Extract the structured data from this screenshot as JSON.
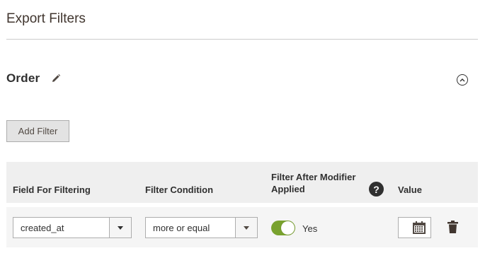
{
  "section": {
    "title": "Export Filters"
  },
  "order": {
    "title": "Order"
  },
  "actions": {
    "add_filter_label": "Add Filter"
  },
  "table": {
    "headers": {
      "field": "Field For Filtering",
      "condition": "Filter Condition",
      "modifier_line1": "Filter After Modifier",
      "modifier_line2": "Applied",
      "value": "Value"
    },
    "help_icon_glyph": "?",
    "row": {
      "field_value": "created_at",
      "condition_value": "more or equal",
      "modifier_toggle_label": "Yes",
      "modifier_toggle_on": true,
      "value": ""
    }
  },
  "colors": {
    "toggle_on": "#79a22e",
    "header_bg": "#efefef",
    "row_bg": "#f5f5f5",
    "button_bg": "#e3e3e3"
  },
  "icons": [
    "pencil-icon",
    "collapse-icon",
    "help-icon",
    "calendar-icon",
    "trash-icon",
    "chevron-down-icon"
  ]
}
